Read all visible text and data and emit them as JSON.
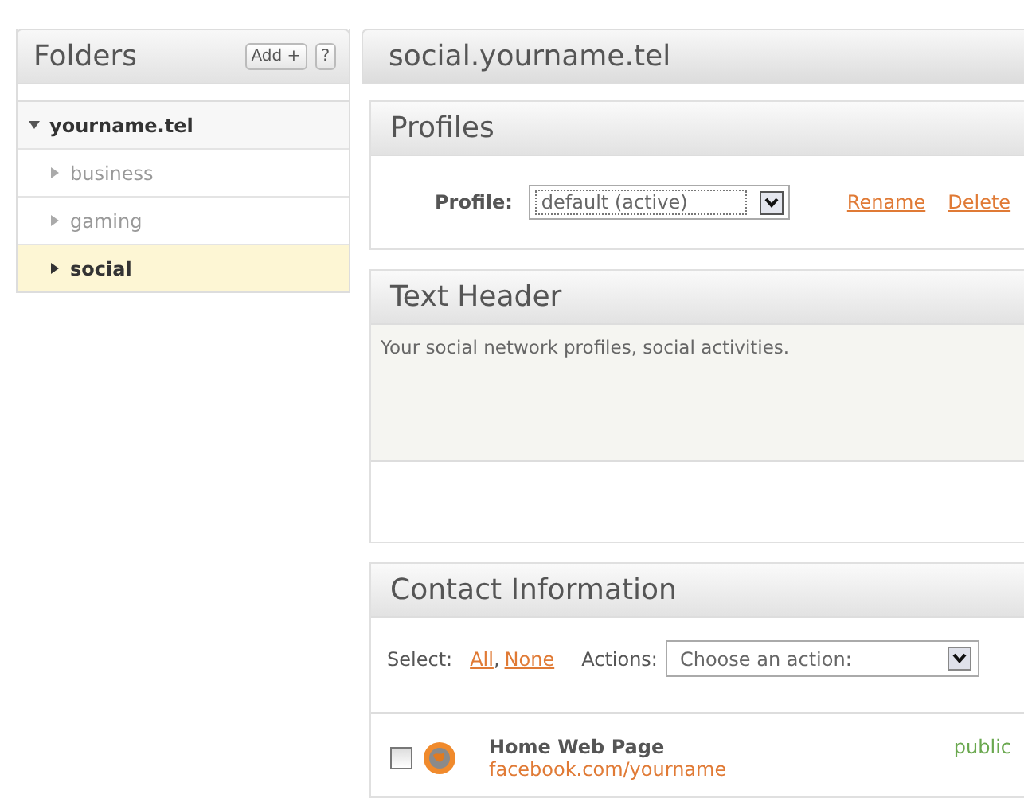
{
  "sidebar": {
    "title": "Folders",
    "add_button": "Add +",
    "help_button": "?",
    "tree": [
      {
        "label": "yourname.tel",
        "expanded": true,
        "selected": false,
        "children": [
          {
            "label": "business",
            "expanded": false,
            "selected": false
          },
          {
            "label": "gaming",
            "expanded": false,
            "selected": false
          },
          {
            "label": "social",
            "expanded": false,
            "selected": true
          }
        ]
      }
    ]
  },
  "main": {
    "title": "social.yourname.tel",
    "profiles": {
      "title": "Profiles",
      "label": "Profile:",
      "value": "default (active)",
      "links": [
        "Rename",
        "Delete"
      ]
    },
    "text_header": {
      "title": "Text Header",
      "text": "Your social network profiles, social activities."
    },
    "contact": {
      "title": "Contact Information",
      "select_label": "Select:",
      "select_links": [
        "All",
        "None"
      ],
      "select_separator": ",",
      "actions_label": "Actions:",
      "actions_value": "Choose an action:",
      "items": [
        {
          "title": "Home Web Page",
          "url": "facebook.com/yourname",
          "visibility": "public",
          "checked": false
        }
      ]
    }
  }
}
